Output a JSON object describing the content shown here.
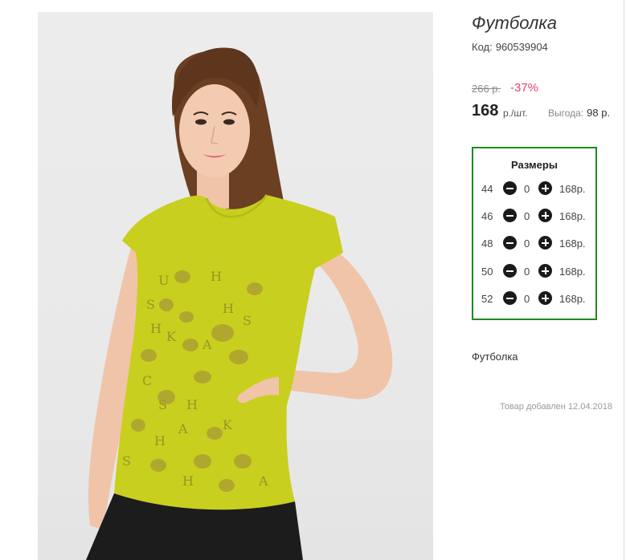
{
  "product": {
    "title": "Футболка",
    "code_label": "Код:",
    "code_value": "960539904",
    "old_price": "266 р.",
    "discount": "-37%",
    "price": "168",
    "price_unit": "р./шт.",
    "savings_label": "Выгода:",
    "savings_value": "98 р.",
    "description": "Футболка",
    "added_text": "Товар добавлен 12.04.2018"
  },
  "sizes": {
    "title": "Размеры",
    "rows": [
      {
        "size": "44",
        "qty": "0",
        "price": "168р."
      },
      {
        "size": "46",
        "qty": "0",
        "price": "168р."
      },
      {
        "size": "48",
        "qty": "0",
        "price": "168р."
      },
      {
        "size": "50",
        "qty": "0",
        "price": "168р."
      },
      {
        "size": "52",
        "qty": "0",
        "price": "168р."
      }
    ]
  },
  "colors": {
    "discount": "#e8436c",
    "sizes_border": "#1f8a1f",
    "shirt": "#c9cf1e"
  },
  "icons": {
    "minus": "minus-circle-icon",
    "plus": "plus-circle-icon"
  }
}
